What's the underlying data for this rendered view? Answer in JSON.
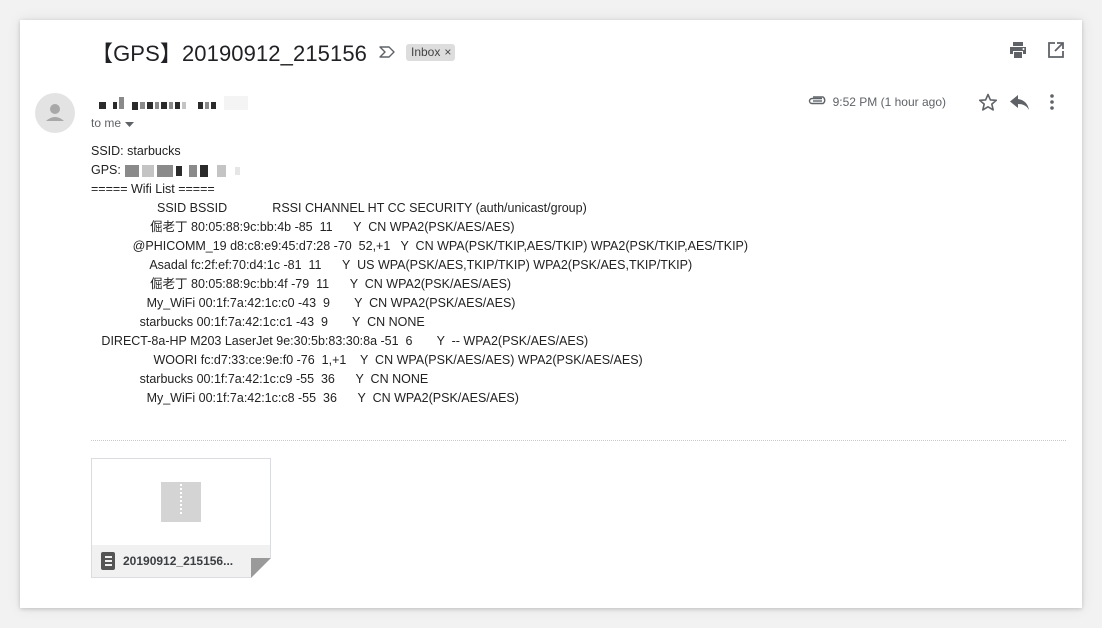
{
  "header": {
    "subject": "【GPS】20190912_215156",
    "label_chip": "Inbox",
    "chip_close": "×"
  },
  "message": {
    "to_me": "to me",
    "time": "9:52 PM (1 hour ago)"
  },
  "body_lines": {
    "ssid": "SSID: starbucks",
    "gps_label": "GPS:",
    "list_header": "===== Wifi List ====="
  },
  "wifi_rows": [
    "                   SSID BSSID             RSSI CHANNEL HT CC SECURITY (auth/unicast/group)",
    "                 倔老丁 80:05:88:9c:bb:4b -85  11      Y  CN WPA2(PSK/AES/AES)",
    "            @PHICOMM_19 d8:c8:e9:45:d7:28 -70  52,+1   Y  CN WPA(PSK/TKIP,AES/TKIP) WPA2(PSK/TKIP,AES/TKIP)",
    "                 Asadal fc:2f:ef:70:d4:1c -81  11      Y  US WPA(PSK/AES,TKIP/TKIP) WPA2(PSK/AES,TKIP/TKIP)",
    "                 倔老丁 80:05:88:9c:bb:4f -79  11      Y  CN WPA2(PSK/AES/AES)",
    "                My_WiFi 00:1f:7a:42:1c:c0 -43  9       Y  CN WPA2(PSK/AES/AES)",
    "              starbucks 00:1f:7a:42:1c:c1 -43  9       Y  CN NONE",
    "   DIRECT-8a-HP M203 LaserJet 9e:30:5b:83:30:8a -51  6       Y  -- WPA2(PSK/AES/AES)",
    "                  WOORI fc:d7:33:ce:9e:f0 -76  1,+1    Y  CN WPA(PSK/AES/AES) WPA2(PSK/AES/AES)",
    "              starbucks 00:1f:7a:42:1c:c9 -55  36      Y  CN NONE",
    "                My_WiFi 00:1f:7a:42:1c:c8 -55  36      Y  CN WPA2(PSK/AES/AES)"
  ],
  "attachment": {
    "name": "20190912_215156..."
  },
  "icons": {
    "important": "important-marker-icon",
    "print": "print-icon",
    "open_new_window": "open-in-new-window-icon",
    "avatar": "default-avatar-icon",
    "dropdown": "caret-down-icon",
    "attachment": "paperclip-icon",
    "star": "star-outline-icon",
    "reply": "reply-icon",
    "more": "more-vert-icon",
    "zip": "zip-file-icon",
    "doc": "archive-type-icon"
  },
  "colors": {
    "card_bg": "#ffffff",
    "page_bg": "#f2f2f2",
    "chip_bg": "#dddddd",
    "icon_gray": "#5f6368",
    "text": "#202124"
  }
}
